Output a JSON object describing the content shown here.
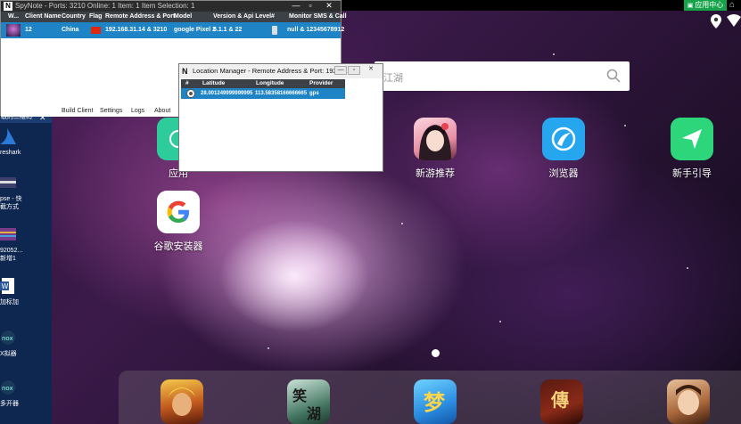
{
  "status_bar": {
    "app_center_label": "应用中心",
    "home_icon": "home-icon",
    "location_icon": "location-pin-icon",
    "wifi_icon": "wifi-icon"
  },
  "search": {
    "text": "江湖",
    "icon": "search-icon"
  },
  "apps": [
    {
      "label": "应用",
      "color": "#2ecc9a"
    },
    {
      "label": "新游推荐",
      "color": "#f3a7b5"
    },
    {
      "label": "浏览器",
      "color": "#27a6f0"
    },
    {
      "label": "新手引导",
      "color": "#2dd67a"
    },
    {
      "label": "谷歌安装器",
      "color": "#ffffff"
    }
  ],
  "desktop_panel": {
    "header": "取的二维码",
    "items": [
      {
        "label": "reshark"
      },
      {
        "label": "pse - 快\n截方式"
      },
      {
        "label": "92052...\n新增1"
      },
      {
        "label": "加标加"
      },
      {
        "label": "X拟器"
      },
      {
        "label": "多开器"
      }
    ]
  },
  "spynote": {
    "title": "SpyNote - Ports: 3210 Online: 1 Item: 1 Item Selection: 1",
    "columns": [
      "W...",
      "Client Name",
      "Country",
      "Flag",
      "Remote Address & Port",
      "Model",
      "Version & Api Level",
      "#",
      "Monitor SMS & Call"
    ],
    "row": {
      "client_name": "12",
      "country": "China",
      "remote_address": "192.168.31.14 & 3210",
      "model": "google Pixel 2",
      "version": "5.1.1 & 22",
      "monitor": "null & 12345678912"
    },
    "menu": [
      "Build Client",
      "Settings",
      "Logs",
      "About"
    ]
  },
  "location_manager": {
    "title": "Location Manager - Remote Address & Port: 192...",
    "columns": [
      "#",
      "Latitude",
      "Longitude",
      "Provider"
    ],
    "row": {
      "latitude": "28.001249999999995",
      "longitude": "113.58358166666665",
      "provider": "gps"
    }
  }
}
